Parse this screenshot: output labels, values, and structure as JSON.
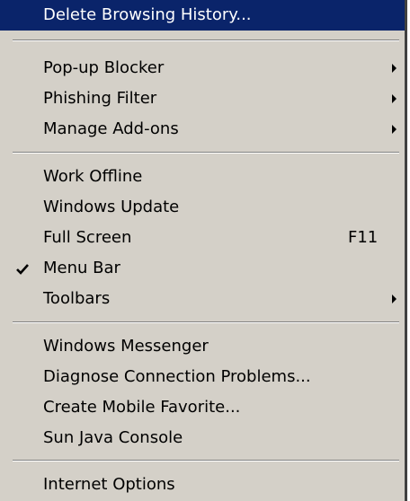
{
  "menu": {
    "delete_history": "Delete Browsing History...",
    "popup_blocker": "Pop-up Blocker",
    "phishing_filter": "Phishing Filter",
    "manage_addons": "Manage Add-ons",
    "work_offline": "Work Offline",
    "windows_update": "Windows Update",
    "full_screen": "Full Screen",
    "full_screen_shortcut": "F11",
    "menu_bar": "Menu Bar",
    "menu_bar_checked": true,
    "toolbars": "Toolbars",
    "windows_messenger": "Windows Messenger",
    "diagnose": "Diagnose Connection Problems...",
    "create_mobile_favorite": "Create Mobile Favorite...",
    "sun_java_console": "Sun Java Console",
    "internet_options": "Internet Options"
  },
  "colors": {
    "menu_bg": "#d4d0c8",
    "highlight_bg": "#0a246a",
    "highlight_text": "#ffffff",
    "text": "#000000"
  },
  "icons": {
    "submenu_arrow": "submenu-arrow-icon",
    "checkmark": "checkmark-icon"
  }
}
